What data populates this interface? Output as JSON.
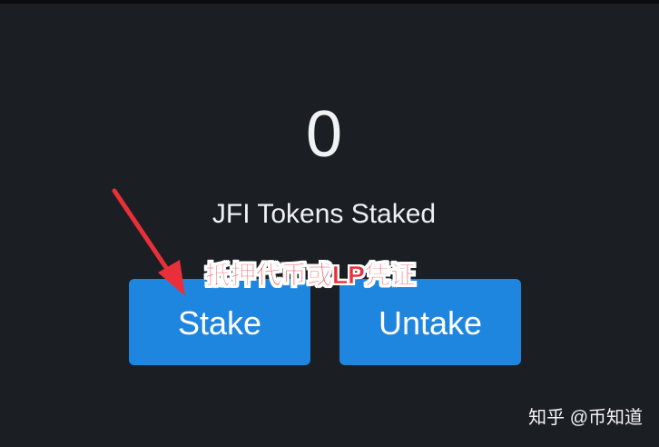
{
  "staking": {
    "amount": "0",
    "caption": "JFI Tokens Staked"
  },
  "actions": {
    "stake_label": "Stake",
    "untake_label": "Untake"
  },
  "annotation": {
    "text": "抵押代币或LP凭证",
    "arrow_icon": "red-arrow-icon",
    "color": "#e9303a"
  },
  "watermark": {
    "text": "知乎 @币知道"
  },
  "colors": {
    "background": "#1b1e23",
    "button": "#1f86e0",
    "text": "#f1f2f4"
  }
}
